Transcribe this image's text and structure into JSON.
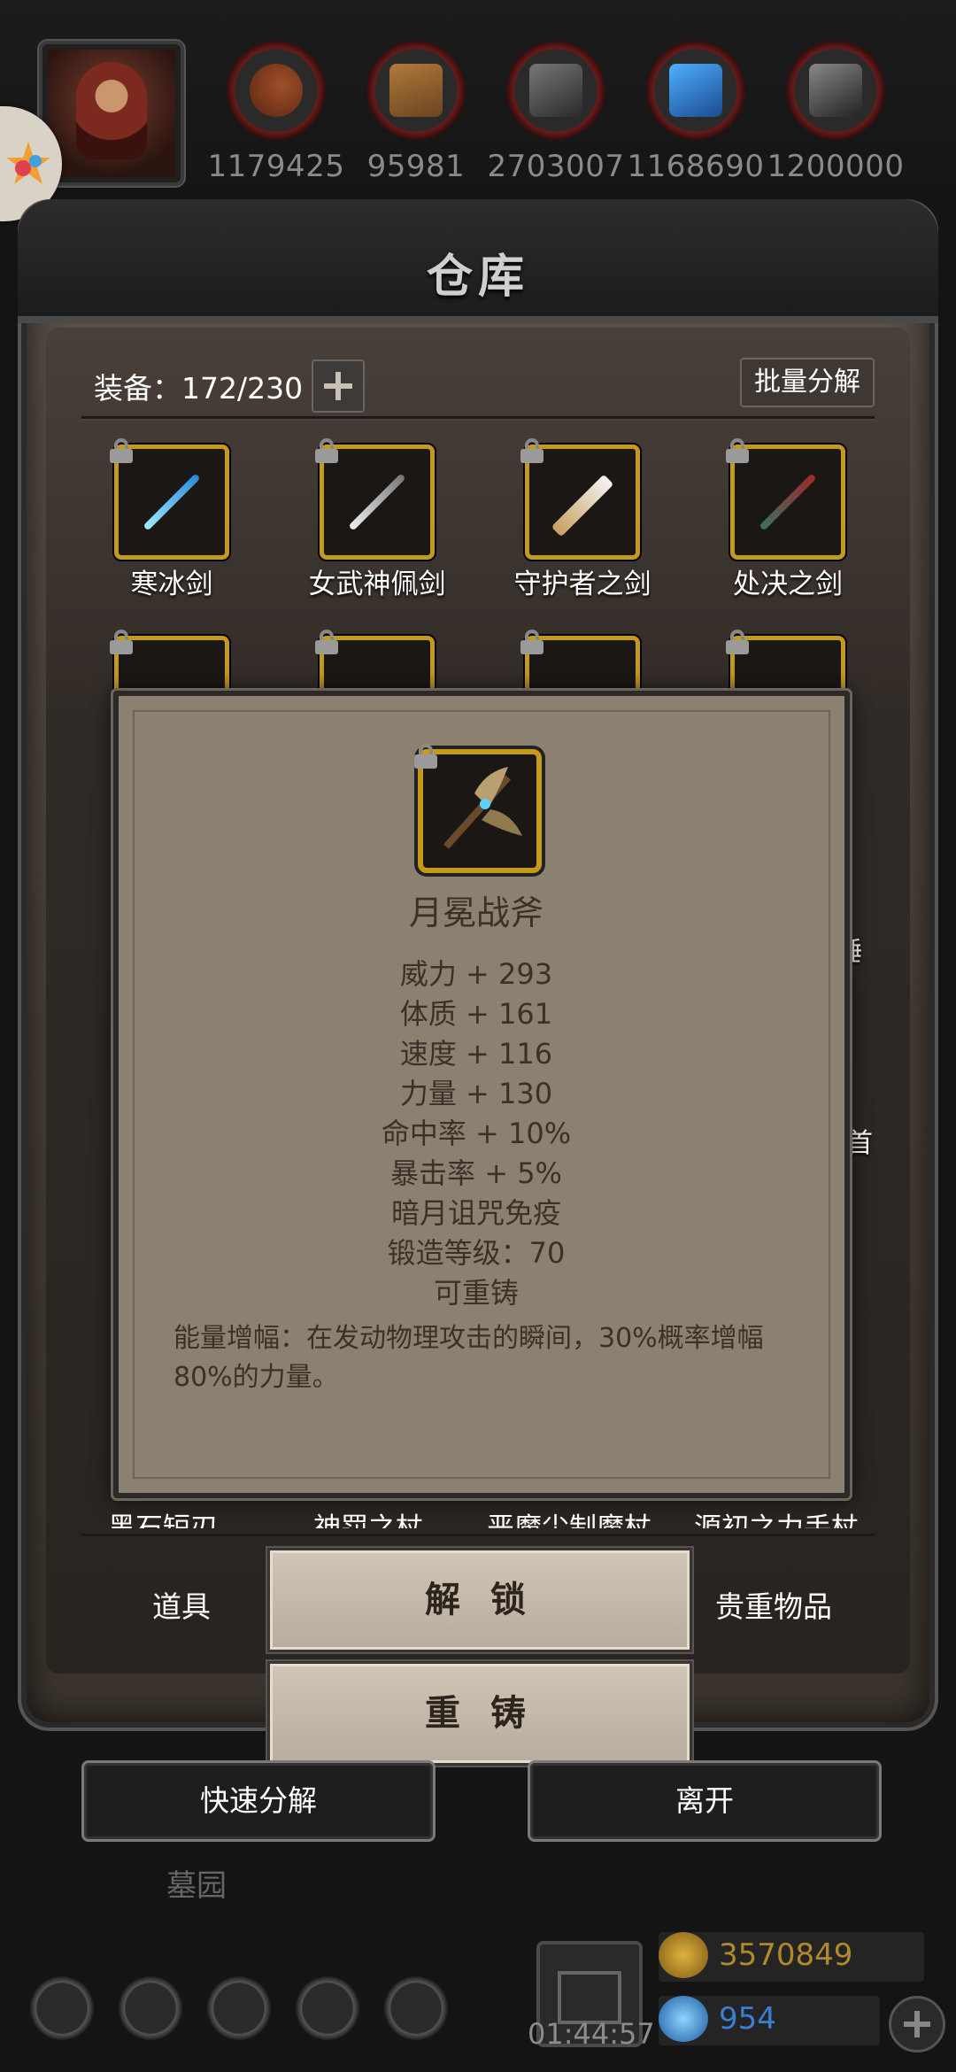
{
  "resources": [
    "1179425",
    "95981",
    "2703007",
    "1168690",
    "1200000"
  ],
  "warehouse": {
    "title": "仓库",
    "equip_count": "装备：172/230",
    "bulk_label": "批量分解",
    "items_row1": [
      "寒冰剑",
      "女武神佩剑",
      "守护者之剑",
      "处决之剑"
    ],
    "side_fragments": [
      "锤",
      "首"
    ],
    "cut_labels": [
      "黑石短刃",
      "神罚之杖",
      "恶魔尘制魔杖",
      "源初之力手杖"
    ]
  },
  "tooltip": {
    "name": "月冕战斧",
    "stats": [
      "威力 + 293",
      "体质 + 161",
      "速度 + 116",
      "力量 + 130",
      "命中率 + 10%",
      "暴击率 + 5%",
      "暗月诅咒免疫",
      "锻造等级：70",
      "可重铸"
    ],
    "description": "能量增幅：在发动物理攻击的瞬间，30%概率增幅80%的力量。"
  },
  "tabs": {
    "left": "道具",
    "right": "贵重物品"
  },
  "buttons": {
    "unlock": "解 锁",
    "reforge": "重 铸",
    "quick_decompose": "快速分解",
    "leave": "离开"
  },
  "footer": {
    "place": "墓园",
    "timer": "01:44:57",
    "gold": "3570849",
    "gems": "954"
  },
  "colors": {
    "gold_text": "#b08a2a",
    "gem_text": "#3a7fd6",
    "slot_border": "#c39a1a"
  }
}
